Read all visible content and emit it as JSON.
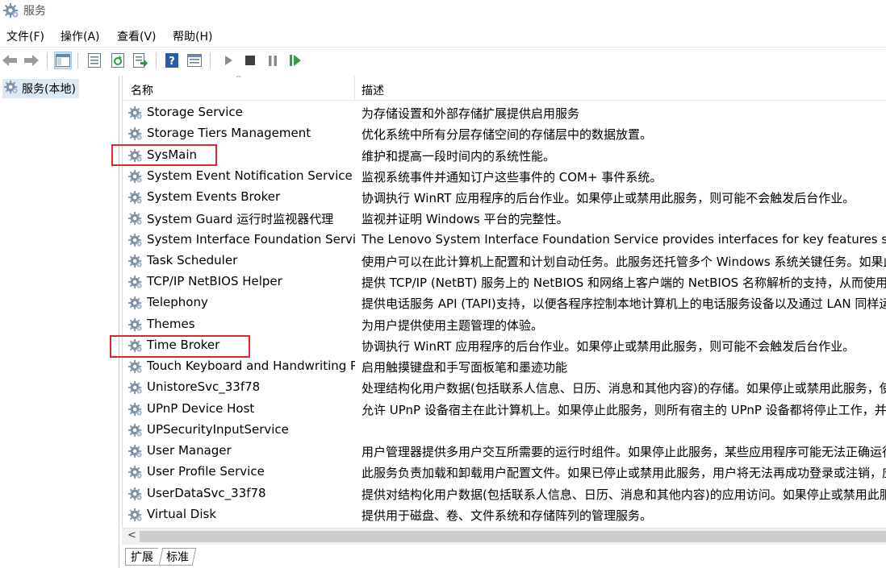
{
  "window": {
    "title": "服务"
  },
  "menu": {
    "file": "文件(F)",
    "action": "操作(A)",
    "view": "查看(V)",
    "help": "帮助(H)"
  },
  "tree": {
    "root": "服务(本地)"
  },
  "table": {
    "col_name": "名称",
    "col_desc": "描述",
    "rows": [
      {
        "name": "Storage Service",
        "desc": "为存储设置和外部存储扩展提供启用服务"
      },
      {
        "name": "Storage Tiers Management",
        "desc": "优化系统中所有分层存储空间的存储层中的数据放置。"
      },
      {
        "name": "SysMain",
        "desc": "维护和提高一段时间内的系统性能。",
        "highlighted": true
      },
      {
        "name": "System Event Notification Service",
        "desc": "监视系统事件并通知订户这些事件的 COM+ 事件系统。"
      },
      {
        "name": "System Events Broker",
        "desc": "协调执行 WinRT 应用程序的后台作业。如果停止或禁用此服务，则可能不会触发后台作业。"
      },
      {
        "name": "System Guard 运行时监视器代理",
        "desc": "监视并证明 Windows 平台的完整性。"
      },
      {
        "name": "System Interface Foundation Service",
        "desc": "The Lenovo System Interface Foundation Service provides interfaces for key features such as: sys"
      },
      {
        "name": "Task Scheduler",
        "desc": "使用户可以在此计算机上配置和计划自动任务。此服务还托管多个 Windows 系统关键任务。如果此"
      },
      {
        "name": "TCP/IP NetBIOS Helper",
        "desc": "提供 TCP/IP (NetBT) 服务上的 NetBIOS 和网络上客户端的 NetBIOS 名称解析的支持，从而使用户"
      },
      {
        "name": "Telephony",
        "desc": "提供电话服务 API (TAPI)支持，以便各程序控制本地计算机上的电话服务设备以及通过 LAN 同样运行"
      },
      {
        "name": "Themes",
        "desc": "为用户提供使用主题管理的体验。"
      },
      {
        "name": "Time Broker",
        "desc": "协调执行 WinRT 应用程序的后台作业。如果停止或禁用此服务，则可能不会触发后台作业。",
        "highlighted": true
      },
      {
        "name": "Touch Keyboard and Handwriting Pa...",
        "desc": "启用触摸键盘和手写面板笔和墨迹功能"
      },
      {
        "name": "UnistoreSvc_33f78",
        "desc": "处理结构化用户数据(包括联系人信息、日历、消息和其他内容)的存储。如果停止或禁用此服务，使"
      },
      {
        "name": "UPnP Device Host",
        "desc": "允许 UPnP 设备宿主在此计算机上。如果停止此服务，则所有宿主的 UPnP 设备都将停止工作，并且"
      },
      {
        "name": "UPSecurityInputService",
        "desc": ""
      },
      {
        "name": "User Manager",
        "desc": "用户管理器提供多用户交互所需要的运行时组件。如果停止此服务，某些应用程序可能无法正确运行"
      },
      {
        "name": "User Profile Service",
        "desc": "此服务负责加载和卸载用户配置文件。如果已停止或禁用此服务，用户将无法再成功登录或注销，应"
      },
      {
        "name": "UserDataSvc_33f78",
        "desc": "提供对结构化用户数据(包括联系人信息、日历、消息和其他内容)的应用访问。如果停止或禁用此服"
      },
      {
        "name": "Virtual Disk",
        "desc": "提供用于磁盘、卷、文件系统和存储阵列的管理服务。"
      }
    ]
  },
  "tabs": {
    "extended": "扩展",
    "standard": "标准"
  },
  "colors": {
    "highlight_box": "#d9292c",
    "selection_bg": "#dde9f5"
  }
}
